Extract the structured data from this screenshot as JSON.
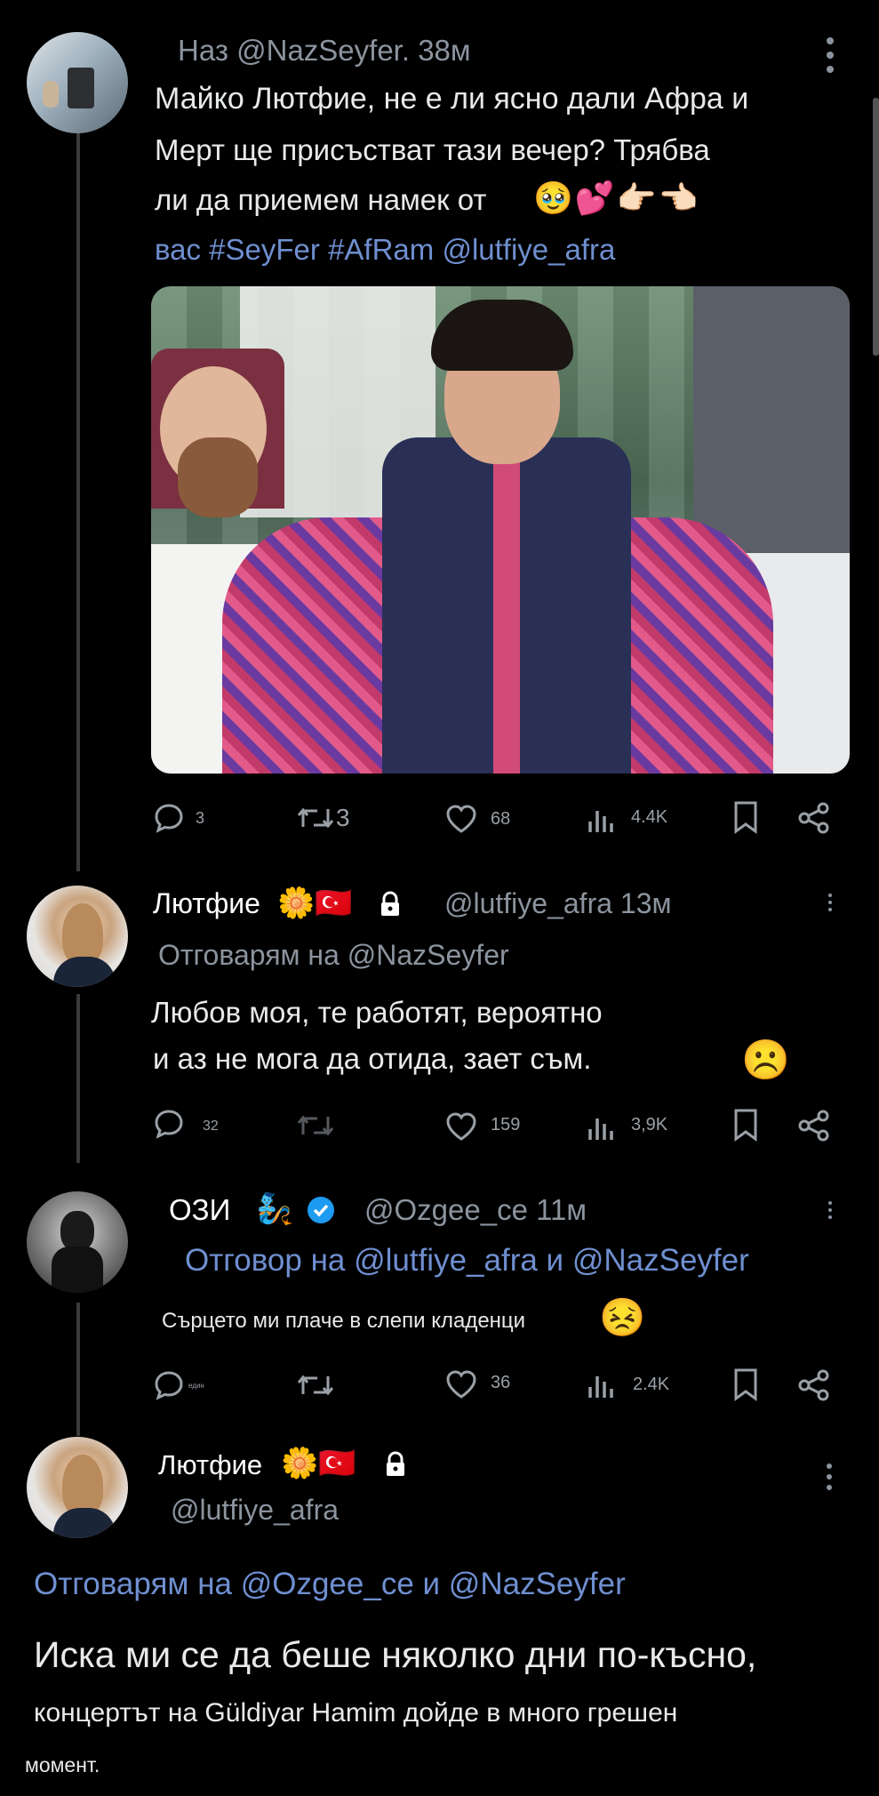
{
  "colors": {
    "background": "#000000",
    "text": "#e7e9ea",
    "muted": "#8b949e",
    "link": "#6f8fd0",
    "thread_line": "#3a3a3a"
  },
  "tweet1": {
    "header": "Наз @NazSeyfer. 38м",
    "line1": "Майко Лютфие, не е ли ясно дали Афра и",
    "line2": "Мерт ще присъстват тази вечер? Трябва",
    "line3": "ли да приемем намек от",
    "line3_emojis": "🥹💕👉🏻👈🏻",
    "tags": "вас #SeyFer #AfRam @lutfiye_afra",
    "replies": "3",
    "retweets": "3",
    "likes": "68",
    "views": "4.4K"
  },
  "tweet2": {
    "name": "Лютфие",
    "name_emojis": "🌼🇹🇷",
    "handle_time": "@lutfiye_afra 13м",
    "reply_to": "Отговарям на @NazSeyfer",
    "line1": "Любов моя, те работят, вероятно",
    "line2": "и аз не мога да отида, зает съм.",
    "emoji": "☹️",
    "replies": "32",
    "likes": "159",
    "views": "3,9K"
  },
  "tweet3": {
    "name": "ОЗИ",
    "name_emoji": "🧞",
    "handle_time": "@Ozgee_ce 11м",
    "reply_to": "Отговор на @lutfiye_afra и @NazSeyfer",
    "text": "Сърцето ми плаче в слепи кладенци",
    "emoji": "😣",
    "replies": "един",
    "likes": "36",
    "views": "2.4K"
  },
  "tweet4": {
    "name": "Лютфие",
    "name_emojis": "🌼🇹🇷",
    "handle": "@lutfiye_afra",
    "reply_to": "Отговарям на @Ozgee_ce и @NazSeyfer",
    "line1": "Иска ми се да беше няколко дни по-късно,",
    "line2": "концертът на Güldiyar Hamim дойде в много грешен",
    "line3": "момент."
  }
}
